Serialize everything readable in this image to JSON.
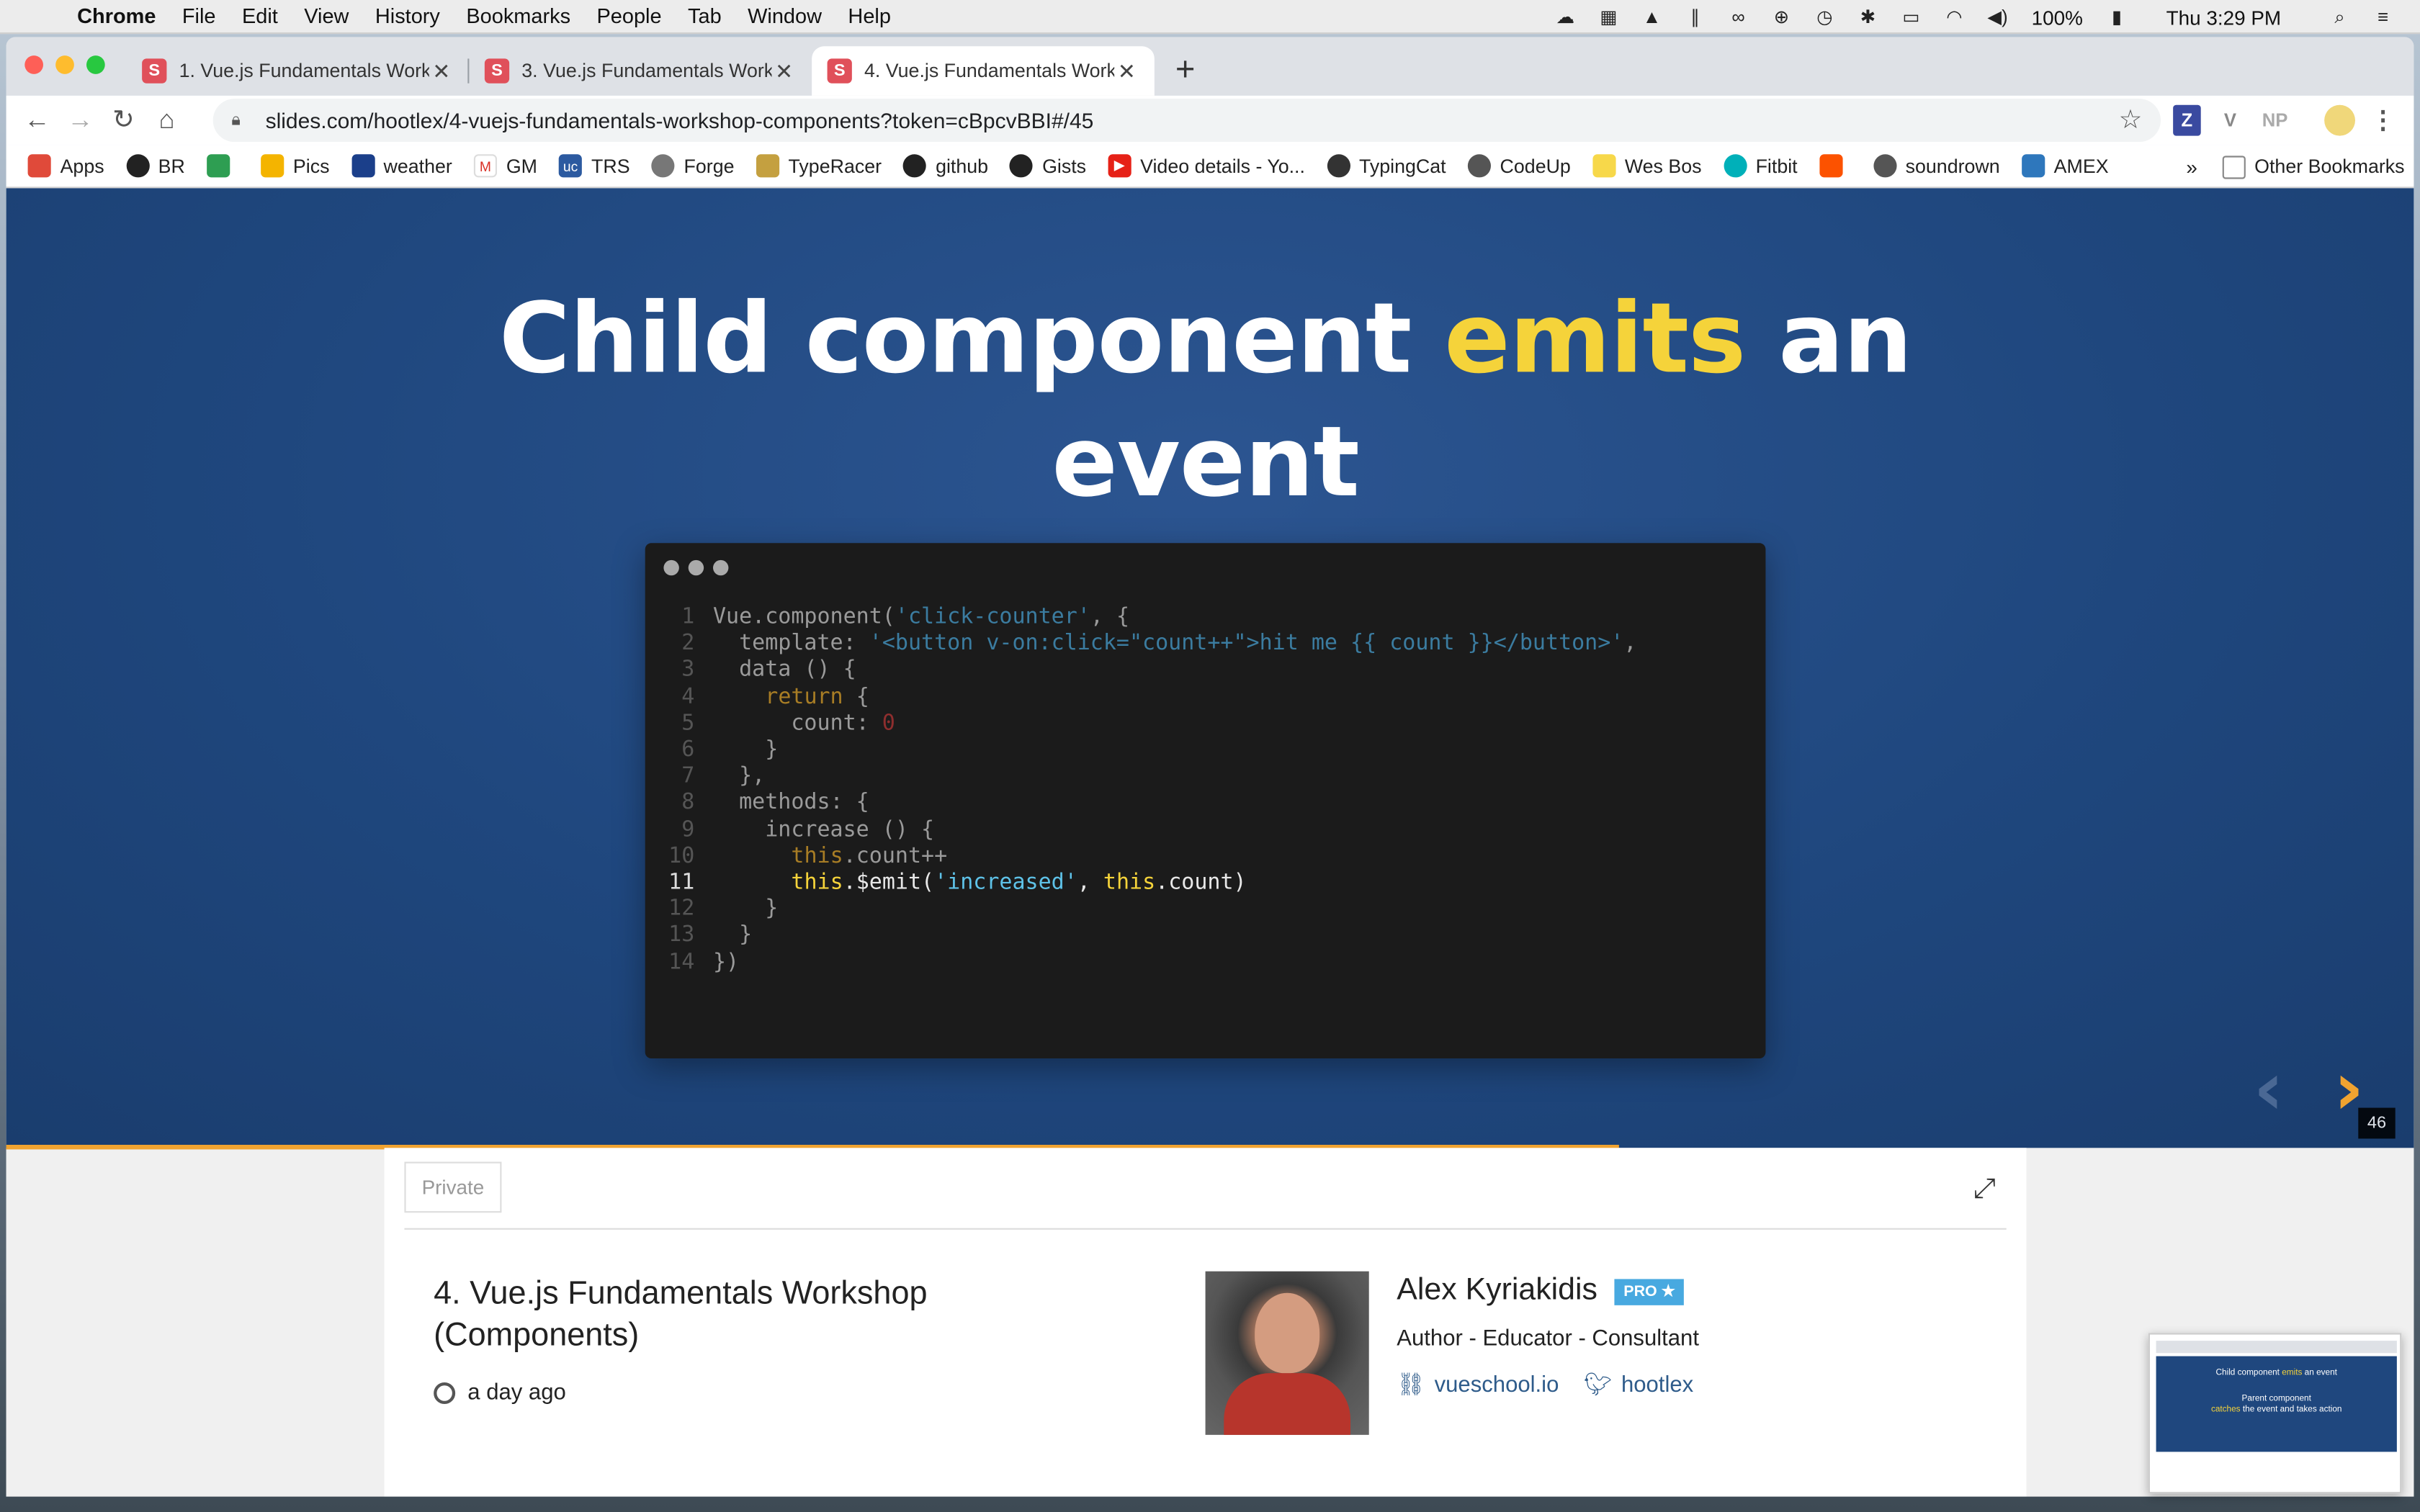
{
  "menubar": {
    "items": [
      "Chrome",
      "File",
      "Edit",
      "View",
      "History",
      "Bookmarks",
      "People",
      "Tab",
      "Window",
      "Help"
    ],
    "battery": "100%",
    "clock": "Thu 3:29 PM"
  },
  "tabs": [
    {
      "title": "1. Vue.js Fundamentals Worksh",
      "favicon": "S"
    },
    {
      "title": "3. Vue.js Fundamentals Worksh",
      "favicon": "S"
    },
    {
      "title": "4. Vue.js Fundamentals Worksh",
      "favicon": "S",
      "active": true
    }
  ],
  "address": {
    "url": "slides.com/hootlex/4-vuejs-fundamentals-workshop-components?token=cBpcvBBI#/45"
  },
  "extensions": [
    "Z",
    "V",
    "NP"
  ],
  "bookmarks": {
    "items": [
      "Apps",
      "BR",
      "",
      "Pics",
      "weather",
      "GM",
      "TRS",
      "Forge",
      "TypeRacer",
      "github",
      "Gists",
      "Video details - Yo...",
      "TypingCat",
      "CodeUp",
      "Wes Bos",
      "Fitbit",
      "",
      "soundrown",
      "AMEX"
    ],
    "overflow": "»",
    "other": "Other Bookmarks"
  },
  "slide": {
    "title_pre": "Child component ",
    "title_hl": "emits",
    "title_post": " an event",
    "slide_number": "46",
    "progress_fraction": 0.67
  },
  "code": {
    "lines": [
      "Vue.component('click-counter', {",
      "  template: '<button v-on:click=\"count++\">hit me {{ count }}</button>',",
      "  data () {",
      "    return {",
      "      count: 0",
      "    }",
      "  },",
      "  methods: {",
      "    increase () {",
      "      this.count++",
      "      this.$emit('increased', this.count)",
      "    }",
      "  }",
      "})"
    ],
    "highlight_line": 11
  },
  "deck": {
    "visibility": "Private",
    "title": "4. Vue.js Fundamentals Workshop (Components)",
    "updated": "a day ago"
  },
  "author": {
    "name": "Alex Kyriakidis",
    "badge": "PRO ★",
    "bio": "Author - Educator - Consultant",
    "website": "vueschool.io",
    "twitter": "hootlex"
  },
  "thumbnail": {
    "title_pre": "Child component ",
    "title_hl": "emits",
    "title_post": " an event",
    "text_pre": "Parent component",
    "text_hl": "catches",
    "text_post": " the event and takes action"
  },
  "colors": {
    "slide_bg": "#1f477e",
    "highlight": "#f5d33a",
    "progress": "#f0a330",
    "pro_badge": "#48a9e0"
  }
}
